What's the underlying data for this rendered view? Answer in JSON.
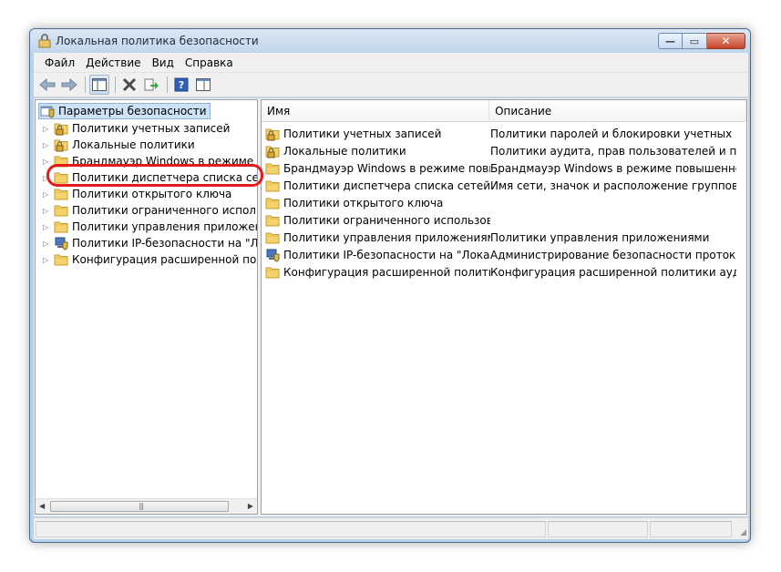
{
  "window": {
    "title": "Локальная политика безопасности"
  },
  "menu": [
    "Файл",
    "Действие",
    "Вид",
    "Справка"
  ],
  "toolbar": [
    "back-icon",
    "forward-icon",
    "show-hide-tree-icon",
    "delete-icon",
    "export-icon",
    "help-icon",
    "properties-icon"
  ],
  "tree": {
    "root": "Параметры безопасности",
    "items": [
      {
        "label": "Политики учетных записей",
        "icon": "lock-folder-icon"
      },
      {
        "label": "Локальные политики",
        "icon": "lock-folder-icon"
      },
      {
        "label": "Брандмауэр Windows в режиме пов",
        "icon": "folder-icon"
      },
      {
        "label": "Политики диспетчера списка сетей",
        "icon": "folder-icon"
      },
      {
        "label": "Политики открытого ключа",
        "icon": "folder-icon"
      },
      {
        "label": "Политики ограниченного использо",
        "icon": "folder-icon"
      },
      {
        "label": "Политики управления приложения",
        "icon": "folder-icon"
      },
      {
        "label": "Политики IP-безопасности на \"Лока",
        "icon": "ipsec-icon"
      },
      {
        "label": "Конфигурация расширенной полит",
        "icon": "folder-icon"
      }
    ]
  },
  "list": {
    "columns": [
      "Имя",
      "Описание"
    ],
    "rows": [
      {
        "name": "Политики учетных записей",
        "desc": "Политики паролей и блокировки учетных за...",
        "icon": "lock-folder-icon"
      },
      {
        "name": "Локальные политики",
        "desc": "Политики аудита, прав пользователей и пар...",
        "icon": "lock-folder-icon"
      },
      {
        "name": "Брандмауэр Windows в режиме повы...",
        "desc": "Брандмауэр Windows в режиме повышенно...",
        "icon": "folder-icon"
      },
      {
        "name": "Политики диспетчера списка сетей",
        "desc": "Имя сети, значок и расположение групповы...",
        "icon": "folder-icon"
      },
      {
        "name": "Политики открытого ключа",
        "desc": "",
        "icon": "folder-icon"
      },
      {
        "name": "Политики ограниченного использован...",
        "desc": "",
        "icon": "folder-icon"
      },
      {
        "name": "Политики управления приложениями",
        "desc": "Политики управления приложениями",
        "icon": "folder-icon"
      },
      {
        "name": "Политики IP-безопасности на \"Локаль...",
        "desc": "Администрирование безопасности проток...",
        "icon": "ipsec-icon"
      },
      {
        "name": "Конфигурация расширенной политик...",
        "desc": "Конфигурация расширенной политики аудита",
        "icon": "folder-icon"
      }
    ]
  },
  "colors": {
    "highlight": "#e31b1b",
    "selection": "#cde2f7",
    "folder": "#f5d26c"
  }
}
